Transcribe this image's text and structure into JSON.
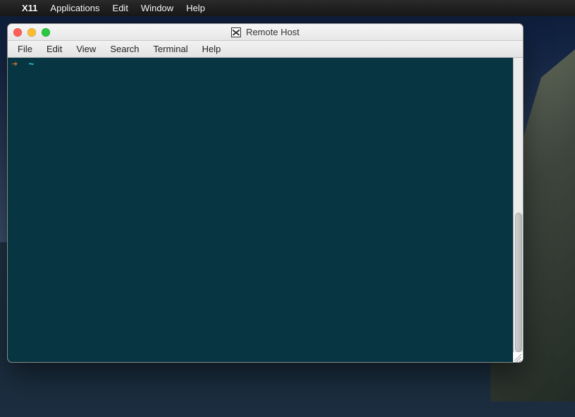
{
  "system_menubar": {
    "apple_glyph": "",
    "app_name": "X11",
    "items": [
      "Applications",
      "Edit",
      "Window",
      "Help"
    ]
  },
  "window": {
    "title": "Remote Host",
    "menu": [
      "File",
      "Edit",
      "View",
      "Search",
      "Terminal",
      "Help"
    ]
  },
  "terminal": {
    "prompt_arrow": "➜",
    "cwd": "~",
    "input": ""
  },
  "colors": {
    "terminal_bg": "#073642",
    "prompt_arrow": "#cb7a2b",
    "tilde": "#2dd4d4"
  }
}
